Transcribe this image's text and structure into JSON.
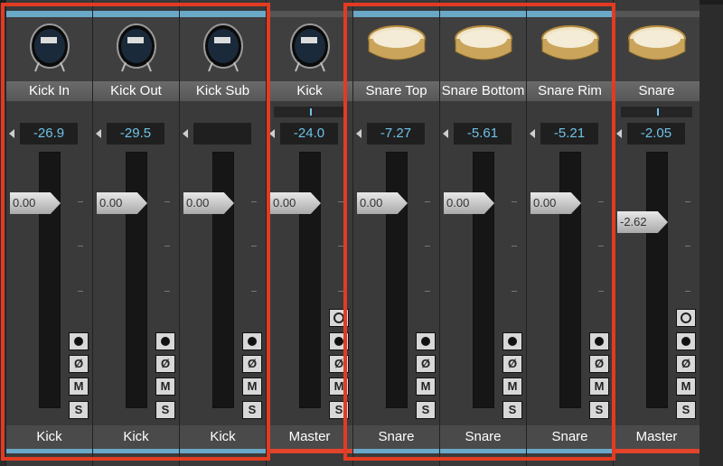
{
  "strips": [
    {
      "name": "Kick In",
      "volume": "-26.9",
      "fader": "0.00",
      "output": "Kick",
      "icon": "kick-drum-icon",
      "buttons": [
        "record",
        "phase",
        "mute",
        "solo"
      ],
      "pan": false
    },
    {
      "name": "Kick Out",
      "volume": "-29.5",
      "fader": "0.00",
      "output": "Kick",
      "icon": "kick-drum-icon",
      "buttons": [
        "record",
        "phase",
        "mute",
        "solo"
      ],
      "pan": false
    },
    {
      "name": "Kick Sub",
      "volume": "",
      "fader": "0.00",
      "output": "Kick",
      "icon": "kick-drum-icon",
      "buttons": [
        "record",
        "phase",
        "mute",
        "solo"
      ],
      "pan": false
    },
    {
      "name": "Kick",
      "volume": "-24.0",
      "fader": "0.00",
      "output": "Master",
      "icon": "kick-drum-icon",
      "buttons": [
        "input",
        "record",
        "phase",
        "mute",
        "solo"
      ],
      "pan": true
    },
    {
      "name": "Snare Top",
      "volume": "-7.27",
      "fader": "0.00",
      "output": "Snare",
      "icon": "snare-drum-icon",
      "buttons": [
        "record",
        "phase",
        "mute",
        "solo"
      ],
      "pan": false
    },
    {
      "name": "Snare Bottom",
      "volume": "-5.61",
      "fader": "0.00",
      "output": "Snare",
      "icon": "snare-drum-icon",
      "buttons": [
        "record",
        "phase",
        "mute",
        "solo"
      ],
      "pan": false
    },
    {
      "name": "Snare Rim",
      "volume": "-5.21",
      "fader": "0.00",
      "output": "Snare",
      "icon": "snare-drum-icon",
      "buttons": [
        "record",
        "phase",
        "mute",
        "solo"
      ],
      "pan": false
    },
    {
      "name": "Snare",
      "volume": "-2.05",
      "fader": "-2.62",
      "output": "Master",
      "icon": "snare-drum-icon",
      "buttons": [
        "input",
        "record",
        "phase",
        "mute",
        "solo"
      ],
      "pan": true
    }
  ],
  "button_glyphs": {
    "phase": "Ø",
    "mute": "M",
    "solo": "S"
  },
  "colors": {
    "highlight": "#e23b22",
    "value_text": "#6ec2e8",
    "track_bar": "#6aa8c8"
  }
}
